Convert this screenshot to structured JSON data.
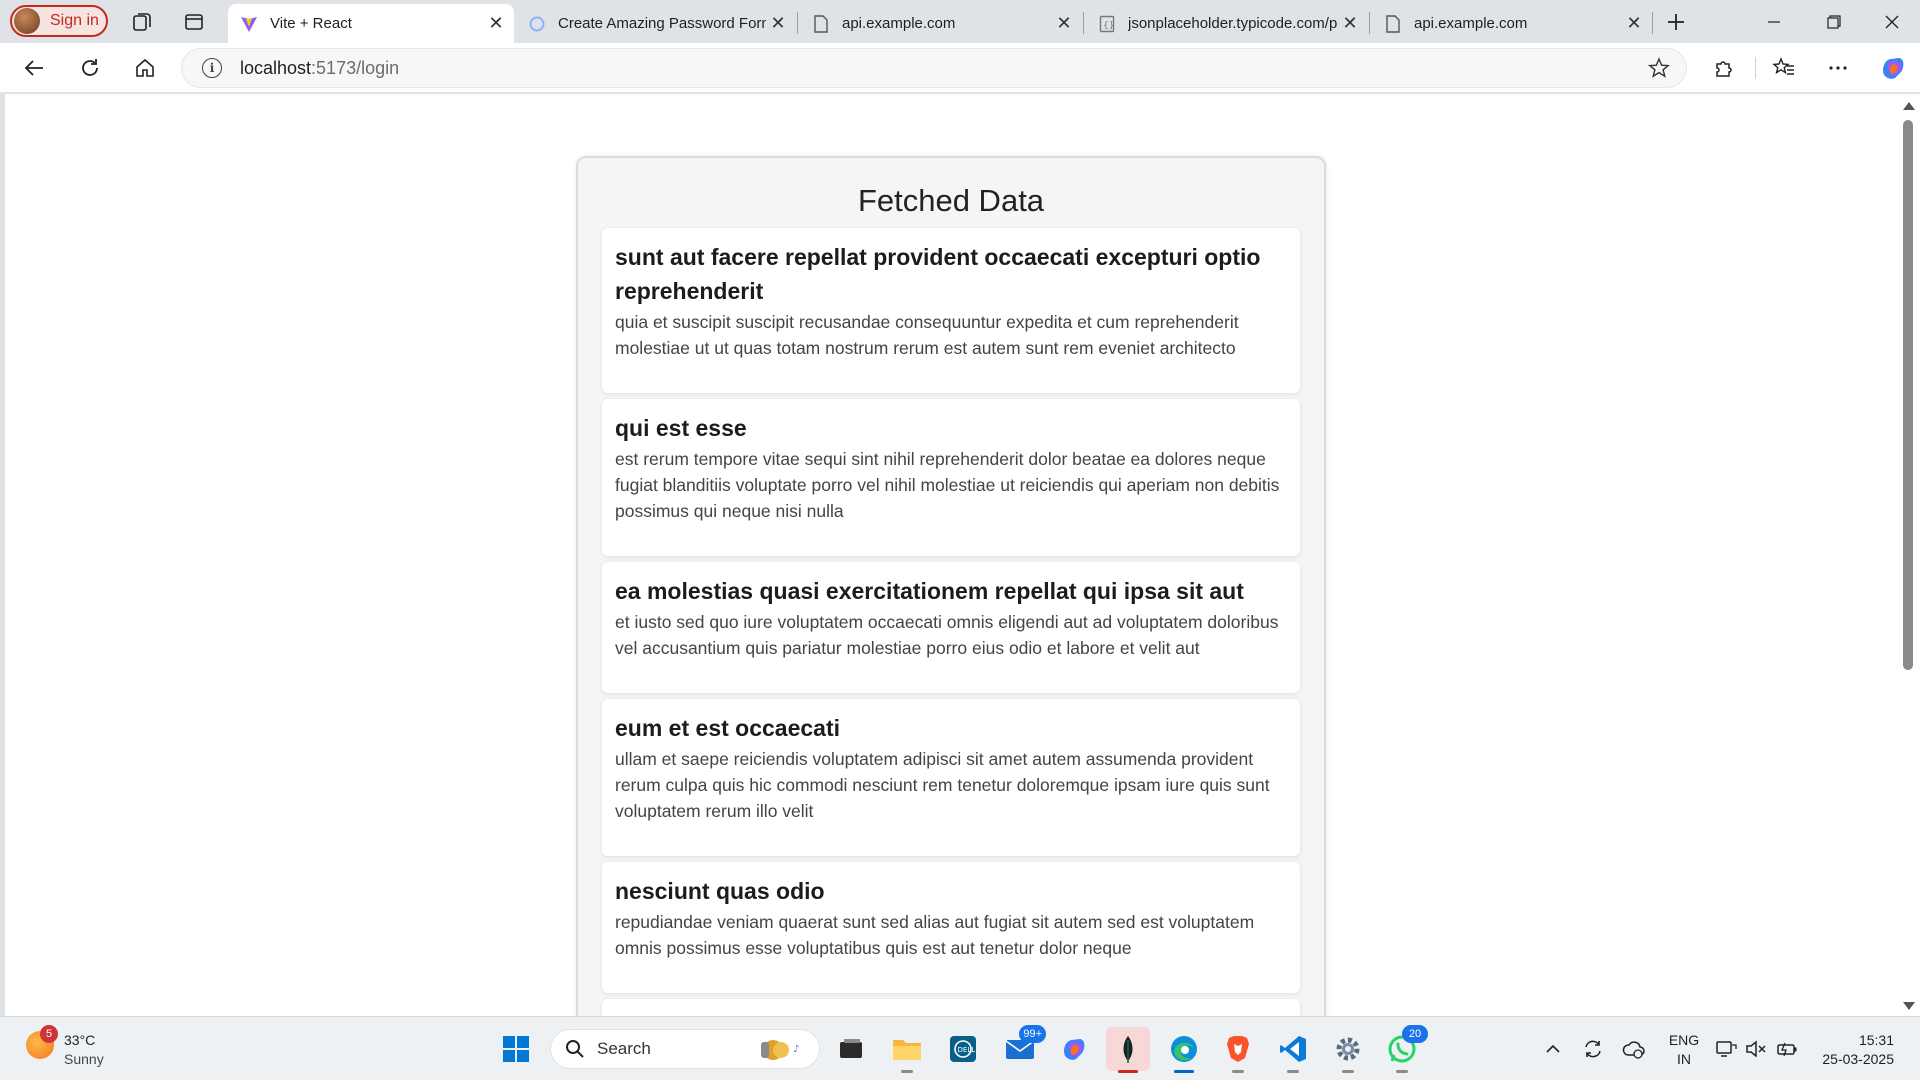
{
  "browser": {
    "signin_label": "Sign in",
    "tabs": [
      {
        "title": "Vite + React",
        "active": true
      },
      {
        "title": "Create Amazing Password Form"
      },
      {
        "title": "api.example.com"
      },
      {
        "title": "jsonplaceholder.typicode.com/p"
      },
      {
        "title": "api.example.com"
      }
    ],
    "url_host": "localhost",
    "url_rest": ":5173/login"
  },
  "page": {
    "heading": "Fetched Data",
    "posts": [
      {
        "title": "sunt aut facere repellat provident occaecati excepturi optio reprehenderit",
        "body": "quia et suscipit suscipit recusandae consequuntur expedita et cum reprehenderit molestiae ut ut quas totam nostrum rerum est autem sunt rem eveniet architecto"
      },
      {
        "title": "qui est esse",
        "body": "est rerum tempore vitae sequi sint nihil reprehenderit dolor beatae ea dolores neque fugiat blanditiis voluptate porro vel nihil molestiae ut reiciendis qui aperiam non debitis possimus qui neque nisi nulla"
      },
      {
        "title": "ea molestias quasi exercitationem repellat qui ipsa sit aut",
        "body": "et iusto sed quo iure voluptatem occaecati omnis eligendi aut ad voluptatem doloribus vel accusantium quis pariatur molestiae porro eius odio et labore et velit aut"
      },
      {
        "title": "eum et est occaecati",
        "body": "ullam et saepe reiciendis voluptatem adipisci sit amet autem assumenda provident rerum culpa quis hic commodi nesciunt rem tenetur doloremque ipsam iure quis sunt voluptatem rerum illo velit"
      },
      {
        "title": "nesciunt quas odio",
        "body": "repudiandae veniam quaerat sunt sed alias aut fugiat sit autem sed est voluptatem omnis possimus esse voluptatibus quis est aut tenetur dolor neque"
      }
    ]
  },
  "taskbar": {
    "weather_temp": "33°C",
    "weather_desc": "Sunny",
    "weather_badge": "5",
    "search_label": "Search",
    "mail_badge": "99+",
    "whatsapp_badge": "20",
    "lang_line1": "ENG",
    "lang_line2": "IN",
    "time": "15:31",
    "date": "25-03-2025"
  },
  "colors": {
    "accent_red": "#c42b1c",
    "edge_blue": "#0067c0"
  }
}
